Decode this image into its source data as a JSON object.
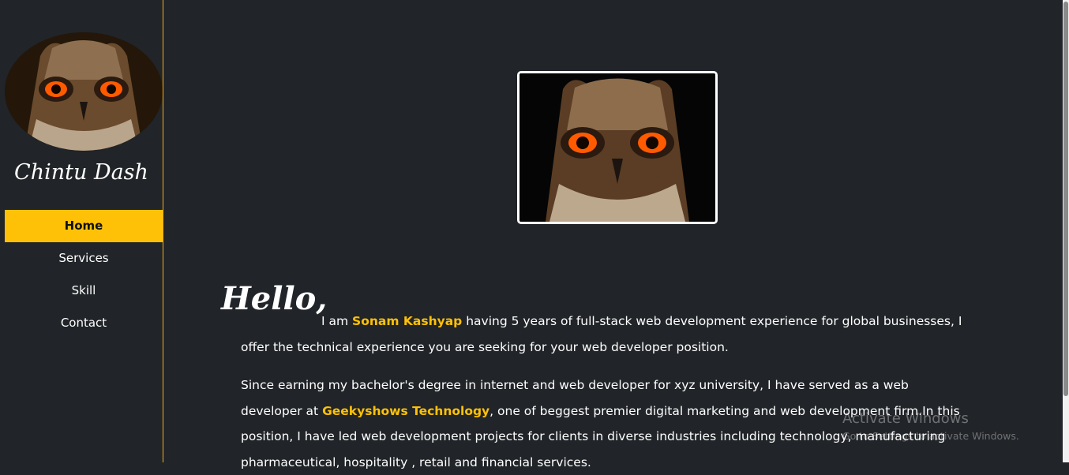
{
  "sidebar": {
    "brand": "Chintu Dash",
    "avatar_icon": "owl-icon",
    "nav": [
      {
        "label": "Home",
        "active": true
      },
      {
        "label": "Services",
        "active": false
      },
      {
        "label": "Skill",
        "active": false
      },
      {
        "label": "Contact",
        "active": false
      }
    ]
  },
  "main": {
    "hero_icon": "owl-icon",
    "greeting": "Hello,",
    "intro_prefix": "I am ",
    "name": "Sonam Kashyap",
    "intro_rest": " having 5 years of full-stack web development experience for global businesses, I offer the technical experience you are seeking for your web developer position.",
    "para2_prefix": "Since earning my bachelor's degree in internet and web developer for xyz university, I have served as a web developer at ",
    "company": "Geekyshows Technology",
    "para2_rest": ", one of beggest premier digital marketing and web development firm.In this position, I have led web development projects for clients in diverse industries including technology, manufacturing pharmaceutical, hospitality , retail and financial services."
  },
  "watermark": {
    "title": "Activate Windows",
    "subtitle": "Go to Settings to activate Windows."
  },
  "colors": {
    "accent": "#ffc107",
    "background": "#212428"
  }
}
